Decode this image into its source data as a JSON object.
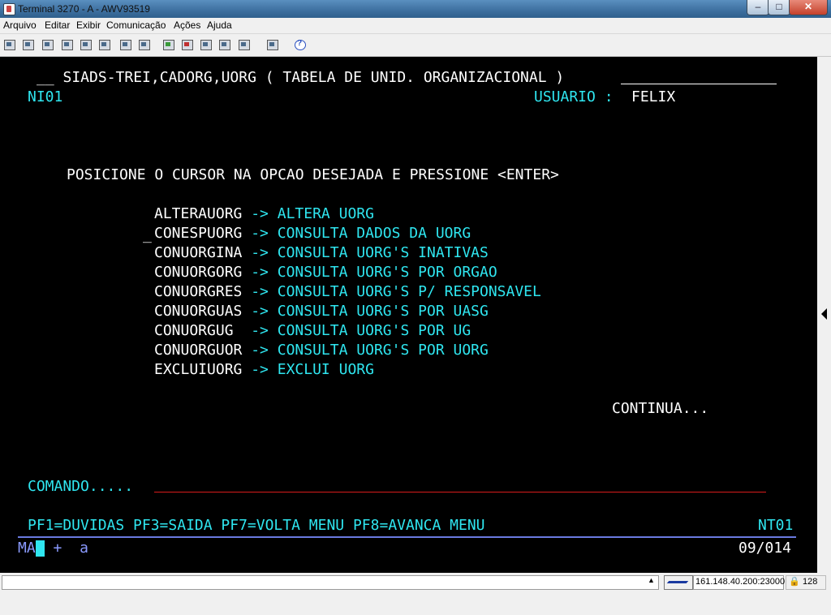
{
  "window": {
    "title": "Terminal 3270 - A - AWV93519",
    "minimize": "–",
    "maximize": "□",
    "close": "✕"
  },
  "menu": [
    "Arquivo",
    "Editar",
    "Exibir",
    "Comunicação",
    "Ações",
    "Ajuda"
  ],
  "toolbar_icons": [
    "print-screen-icon",
    "print-setup-icon",
    "transfer-icon",
    "copy-icon",
    "paste-icon",
    "copy-append-icon",
    "cut-icon",
    "keypad-icon",
    "send-file-icon",
    "receive-file-icon",
    "macro-play-icon",
    "macro-record-icon",
    "disconnect-icon",
    "settings-icon",
    "help-icon"
  ],
  "terminal": {
    "header_left": "__ SIADS-TREI,CADORG,UORG ( TABELA DE UNID. ORGANIZACIONAL )",
    "screen_id": "NI01",
    "user_label": "USUARIO :",
    "user_value": "FELIX",
    "instruction": "POSICIONE O CURSOR NA OPCAO DESEJADA E PRESSIONE <ENTER>",
    "cursor_marker": "_",
    "options": [
      {
        "code": "ALTERAUORG",
        "arrow": "->",
        "desc": "ALTERA UORG"
      },
      {
        "code": "CONESPUORG",
        "arrow": "->",
        "desc": "CONSULTA DADOS DA UORG"
      },
      {
        "code": "CONUORGINA",
        "arrow": "->",
        "desc": "CONSULTA UORG'S INATIVAS"
      },
      {
        "code": "CONUORGORG",
        "arrow": "->",
        "desc": "CONSULTA UORG'S POR ORGAO"
      },
      {
        "code": "CONUORGRES",
        "arrow": "->",
        "desc": "CONSULTA UORG'S P/ RESPONSAVEL"
      },
      {
        "code": "CONUORGUAS",
        "arrow": "->",
        "desc": "CONSULTA UORG'S POR UASG"
      },
      {
        "code": "CONUORGUG ",
        "arrow": "->",
        "desc": "CONSULTA UORG'S POR UG"
      },
      {
        "code": "CONUORGUOR",
        "arrow": "->",
        "desc": "CONSULTA UORG'S POR UORG"
      },
      {
        "code": "EXCLUIUORG",
        "arrow": "->",
        "desc": "EXCLUI UORG"
      }
    ],
    "continua": "CONTINUA...",
    "command_label": "COMANDO.....",
    "command_value": "",
    "pf_keys": "PF1=DUVIDAS PF3=SAIDA PF7=VOLTA MENU PF8=AVANCA MENU",
    "pf_code": "NT01",
    "oia_left": "MA",
    "oia_plus": "+",
    "oia_a": "a",
    "oia_cursor_pos": "09/014"
  },
  "statusbar": {
    "host": "161.148.40.200:23000",
    "encryption": "128"
  },
  "colors": {
    "terminal_bg": "#000000",
    "terminal_cyan": "#2fe6f0",
    "terminal_white": "#ffffff",
    "command_underline": "#d81c1c"
  }
}
